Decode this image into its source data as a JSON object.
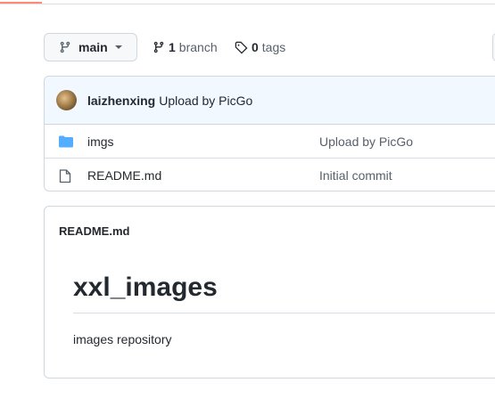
{
  "branch": {
    "name": "main",
    "count": "1",
    "count_label": "branch",
    "tags_count": "0",
    "tags_label": "tags"
  },
  "latest_commit": {
    "author": "laizhenxing",
    "message": "Upload by PicGo"
  },
  "files": [
    {
      "name": "imgs",
      "type": "folder",
      "message": "Upload by PicGo"
    },
    {
      "name": "README.md",
      "type": "file",
      "message": "Initial commit"
    }
  ],
  "readme": {
    "filename": "README.md",
    "title": "xxl_images",
    "body": "images repository"
  },
  "colors": {
    "folder": "#54aeff",
    "tab_underline": "#fd8c73",
    "commit_bg": "#f1f8ff"
  }
}
